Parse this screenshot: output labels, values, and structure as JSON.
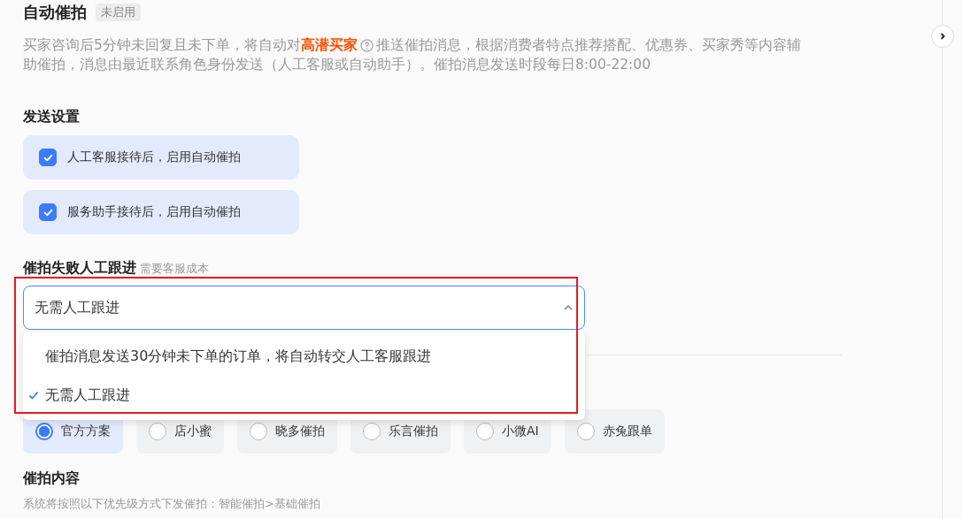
{
  "header": {
    "title": "自动催拍",
    "status_badge": "未启用"
  },
  "description": {
    "before": "买家咨询后5分钟未回复且未下单，将自动对",
    "highlight": "高潜买家",
    "after": "推送催拍消息，根据消费者特点推荐搭配、优惠券、买家秀等内容辅",
    "continuation": "助催拍，消息由最近联系角色身份发送（人工客服或自动助手）。催拍消息发送时段每日8:00-22:00"
  },
  "send_settings": {
    "title": "发送设置",
    "options": [
      {
        "label": "人工客服接待后，启用自动催拍",
        "checked": true
      },
      {
        "label": "服务助手接待后，启用自动催拍",
        "checked": true
      }
    ]
  },
  "follow_up": {
    "title": "催拍失败人工跟进",
    "hint": "需要客服成本",
    "value": "无需人工跟进",
    "expanded": true,
    "options": [
      {
        "label": "催拍消息发送30分钟未下单的订单，将自动转交人工客服跟进",
        "selected": false
      },
      {
        "label": "无需人工跟进",
        "selected": true
      }
    ]
  },
  "plans": [
    {
      "label": "官方方案",
      "selected": true
    },
    {
      "label": "店小蜜",
      "selected": false
    },
    {
      "label": "晓多催拍",
      "selected": false
    },
    {
      "label": "乐言催拍",
      "selected": false
    },
    {
      "label": "小微AI",
      "selected": false
    },
    {
      "label": "赤兔跟单",
      "selected": false
    }
  ],
  "content": {
    "title": "催拍内容",
    "hint": "系统将按照以下优先级方式下发催拍：智能催拍>基础催拍"
  }
}
